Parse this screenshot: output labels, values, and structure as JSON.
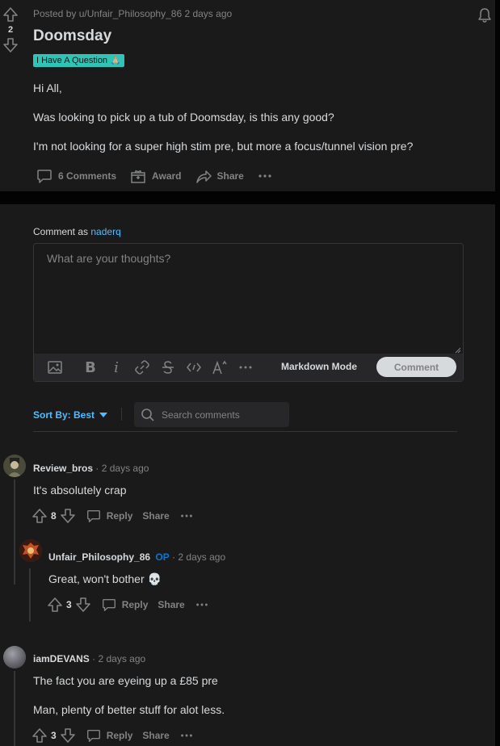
{
  "post": {
    "score": "2",
    "meta": "Posted by u/Unfair_Philosophy_86 2 days ago",
    "title": "Doomsday",
    "flair": "I Have A Question 🙏🏼",
    "body": [
      "Hi All,",
      "Was looking to pick up a tub of Doomsday, is this any good?",
      "I'm not looking for a super high stim pre, but more a focus/tunnel vision pre?"
    ],
    "actions": {
      "comments": "6 Comments",
      "award": "Award",
      "share": "Share"
    }
  },
  "comment_form": {
    "prefix": "Comment as",
    "username": "naderq",
    "placeholder": "What are your thoughts?",
    "markdown_mode": "Markdown Mode",
    "submit": "Comment"
  },
  "sort": {
    "label": "Sort By: Best",
    "search_placeholder": "Search comments"
  },
  "comments": [
    {
      "author": "Review_bros",
      "time": "· 2 days ago",
      "text": "It's absolutely crap",
      "score": "8",
      "reply": "Reply",
      "share": "Share"
    },
    {
      "author": "Unfair_Philosophy_86",
      "op": "OP",
      "time": "· 2 days ago",
      "text": "Great, won't bother 💀",
      "score": "3",
      "reply": "Reply",
      "share": "Share"
    },
    {
      "author": "iamDEVANS",
      "time": "· 2 days ago",
      "text": "The fact you are eyeing up a £85 pre",
      "text2": "Man, plenty of better stuff for alot less.",
      "score": "3",
      "reply": "Reply",
      "share": "Share"
    }
  ],
  "colors": {
    "accent": "#4fbcff",
    "op": "#0079d3",
    "flair_bg": "#2ec4b6",
    "panel": "#1a1a1b",
    "page": "#030303"
  }
}
